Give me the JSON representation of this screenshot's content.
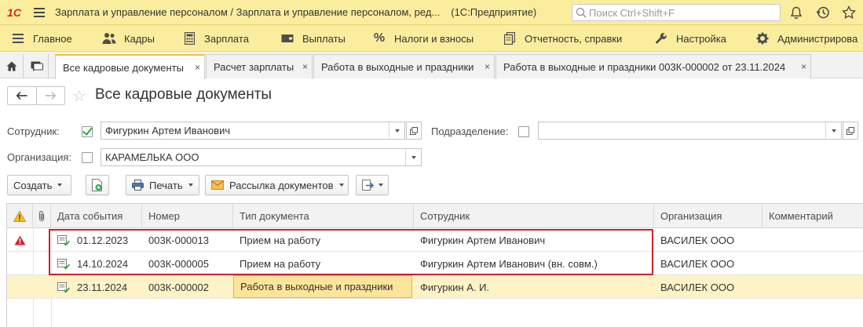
{
  "titlebar": {
    "logo": "1С",
    "title": "Зарплата и управление персоналом / Зарплата и управление персоналом, ред...",
    "app": "(1С:Предприятие)",
    "search_placeholder": "Поиск Ctrl+Shift+F",
    "icons": [
      "hamburger-icon",
      "search-icon",
      "bell-icon",
      "history-icon",
      "star-icon"
    ]
  },
  "menu": [
    {
      "label": "Главное",
      "icon": "hamburger-icon"
    },
    {
      "label": "Кадры",
      "icon": "people-icon"
    },
    {
      "label": "Зарплата",
      "icon": "calculator-icon"
    },
    {
      "label": "Выплаты",
      "icon": "wallet-icon"
    },
    {
      "label": "Налоги и взносы",
      "icon": "percent-icon"
    },
    {
      "label": "Отчетность, справки",
      "icon": "documents-icon"
    },
    {
      "label": "Настройка",
      "icon": "wrench-icon"
    },
    {
      "label": "Администрирова",
      "icon": "gear-icon"
    }
  ],
  "tabs": [
    {
      "label": "Все кадровые документы",
      "active": true
    },
    {
      "label": "Расчет зарплаты",
      "active": false
    },
    {
      "label": "Работа в выходные и праздники",
      "active": false
    },
    {
      "label": "Работа в выходные и праздники 003К-000002 от 23.11.2024",
      "active": false
    }
  ],
  "tab_close": "×",
  "form": {
    "title": "Все кадровые документы",
    "filters": {
      "employee_label": "Сотрудник:",
      "employee_checked": true,
      "employee_value": "Фигуркин Артем Иванович",
      "department_label": "Подразделение:",
      "department_checked": false,
      "department_value": "",
      "organization_label": "Организация:",
      "organization_checked": false,
      "organization_value": "КАРАМЕЛЬКА ООО"
    },
    "commands": {
      "create": "Создать",
      "print": "Печать",
      "mailing": "Рассылка документов"
    }
  },
  "table": {
    "columns": [
      "Дата события",
      "Номер",
      "Тип документа",
      "Сотрудник",
      "Организация",
      "Комментарий"
    ],
    "rows": [
      {
        "warning": true,
        "date": "01.12.2023",
        "number": "003К-000013",
        "type": "Прием на работу",
        "employee": "Фигуркин Артем Иванович",
        "organization": "ВАСИЛЕК ООО",
        "comment": ""
      },
      {
        "warning": false,
        "date": "14.10.2024",
        "number": "003К-000005",
        "type": "Прием на работу",
        "employee": "Фигуркин Артем Иванович (вн. совм.)",
        "organization": "ВАСИЛЕК ООО",
        "comment": ""
      },
      {
        "warning": false,
        "date": "23.11.2024",
        "number": "003К-000002",
        "type": "Работа в выходные и праздники",
        "employee": "Фигуркин А. И.",
        "organization": "ВАСИЛЕК ООО",
        "comment": "",
        "selected": true
      }
    ]
  },
  "colors": {
    "accent": "#fbed9e",
    "selection": "#fdf3c7",
    "highlight": "#d0202a",
    "checkmark": "#25a93a"
  }
}
